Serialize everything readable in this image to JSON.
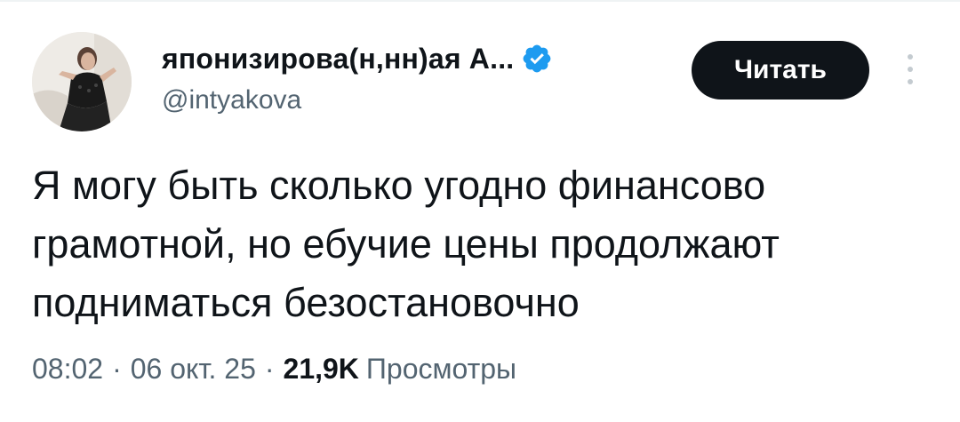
{
  "tweet": {
    "author": {
      "display_name": "японизирова(н,нн)ая А...",
      "handle": "@intyakova",
      "verified": true,
      "avatar_icon": "profile-photo"
    },
    "follow_label": "Читать",
    "more_icon": "vertical-ellipsis-icon",
    "text": "Я могу быть сколько угодно финансово\nграмотной, но ебучие цены продолжают\nподниматься безостановочно",
    "time": "08:02",
    "date": "06 окт. 25",
    "separator": "·",
    "views_count": "21,9K",
    "views_label": "Просмотры"
  },
  "colors": {
    "text_primary": "#0f1419",
    "text_secondary": "#536471",
    "verified_blue": "#1d9bf0",
    "button_bg": "#0f1419",
    "button_text": "#ffffff"
  }
}
